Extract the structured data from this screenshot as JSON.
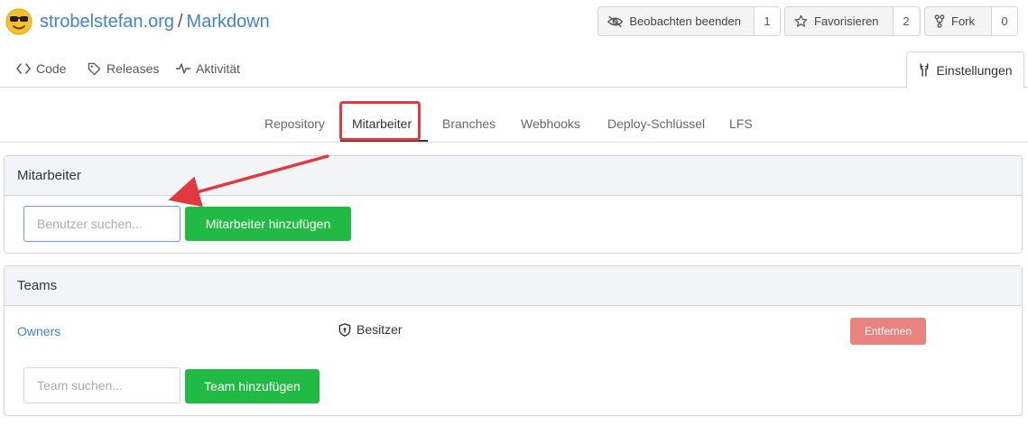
{
  "repo": {
    "owner": "strobelstefan.org",
    "separator": "/",
    "name": "Markdown"
  },
  "actions": {
    "watch": {
      "label": "Beobachten beenden",
      "count": "1"
    },
    "star": {
      "label": "Favorisieren",
      "count": "2"
    },
    "fork": {
      "label": "Fork",
      "count": "0"
    }
  },
  "nav": {
    "code": "Code",
    "releases": "Releases",
    "activity": "Aktivität",
    "settings": "Einstellungen"
  },
  "settings_tabs": [
    "Repository",
    "Mitarbeiter",
    "Branches",
    "Webhooks",
    "Deploy-Schlüssel",
    "LFS"
  ],
  "collaborators": {
    "heading": "Mitarbeiter",
    "search_placeholder": "Benutzer suchen...",
    "add_button": "Mitarbeiter hinzufügen"
  },
  "teams": {
    "heading": "Teams",
    "rows": [
      {
        "name": "Owners",
        "role": "Besitzer",
        "remove": "Entfernen"
      }
    ],
    "search_placeholder": "Team suchen...",
    "add_button": "Team hinzufügen"
  },
  "colors": {
    "link": "#4183c4",
    "primary": "#21ba45",
    "danger": "#e8837f",
    "annotation": "#e0393f"
  }
}
